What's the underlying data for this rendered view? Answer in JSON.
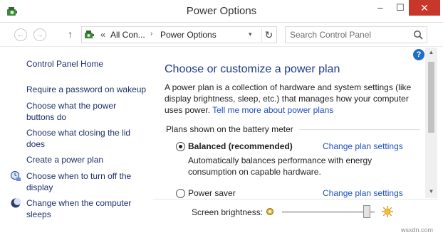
{
  "window": {
    "title": "Power Options",
    "minimize": "–",
    "maximize": "☐",
    "close": "✕"
  },
  "nav": {
    "back": "←",
    "forward": "→",
    "up": "↑",
    "address_sep": "«",
    "breadcrumb_1": "All Con...",
    "breadcrumb_chevron": "›",
    "breadcrumb_2": "Power Options",
    "dropdown": "▾",
    "refresh": "↻",
    "search_placeholder": "Search Control Panel"
  },
  "sidebar": {
    "home": "Control Panel Home",
    "items": [
      {
        "label": "Require a password on wakeup"
      },
      {
        "label": "Choose what the power buttons do"
      },
      {
        "label": "Choose what closing the lid does"
      },
      {
        "label": "Create a power plan"
      },
      {
        "label": "Choose when to turn off the display"
      },
      {
        "label": "Change when the computer sleeps"
      }
    ]
  },
  "main": {
    "help": "?",
    "heading": "Choose or customize a power plan",
    "intro": "A power plan is a collection of hardware and system settings (like display brightness, sleep, etc.) that manages how your computer uses power.",
    "intro_link": "Tell me more about power plans",
    "plans_title": "Plans shown on the battery meter",
    "plans": [
      {
        "name": "Balanced (recommended)",
        "settings": "Change plan settings",
        "selected": true,
        "description": "Automatically balances performance with energy consumption on capable hardware."
      },
      {
        "name": "Power saver",
        "settings": "Change plan settings",
        "selected": false
      }
    ]
  },
  "scrollbar": {
    "up": "▲",
    "down": "▼"
  },
  "bottom": {
    "brightness_label": "Screen brightness:",
    "brightness_level": 0.95
  },
  "watermark": "wsxdn.com",
  "colors": {
    "link": "#1e4fbf",
    "sidebar_link": "#1e2e6a",
    "heading": "#1e3a8a",
    "close_button": "#c7382b"
  }
}
